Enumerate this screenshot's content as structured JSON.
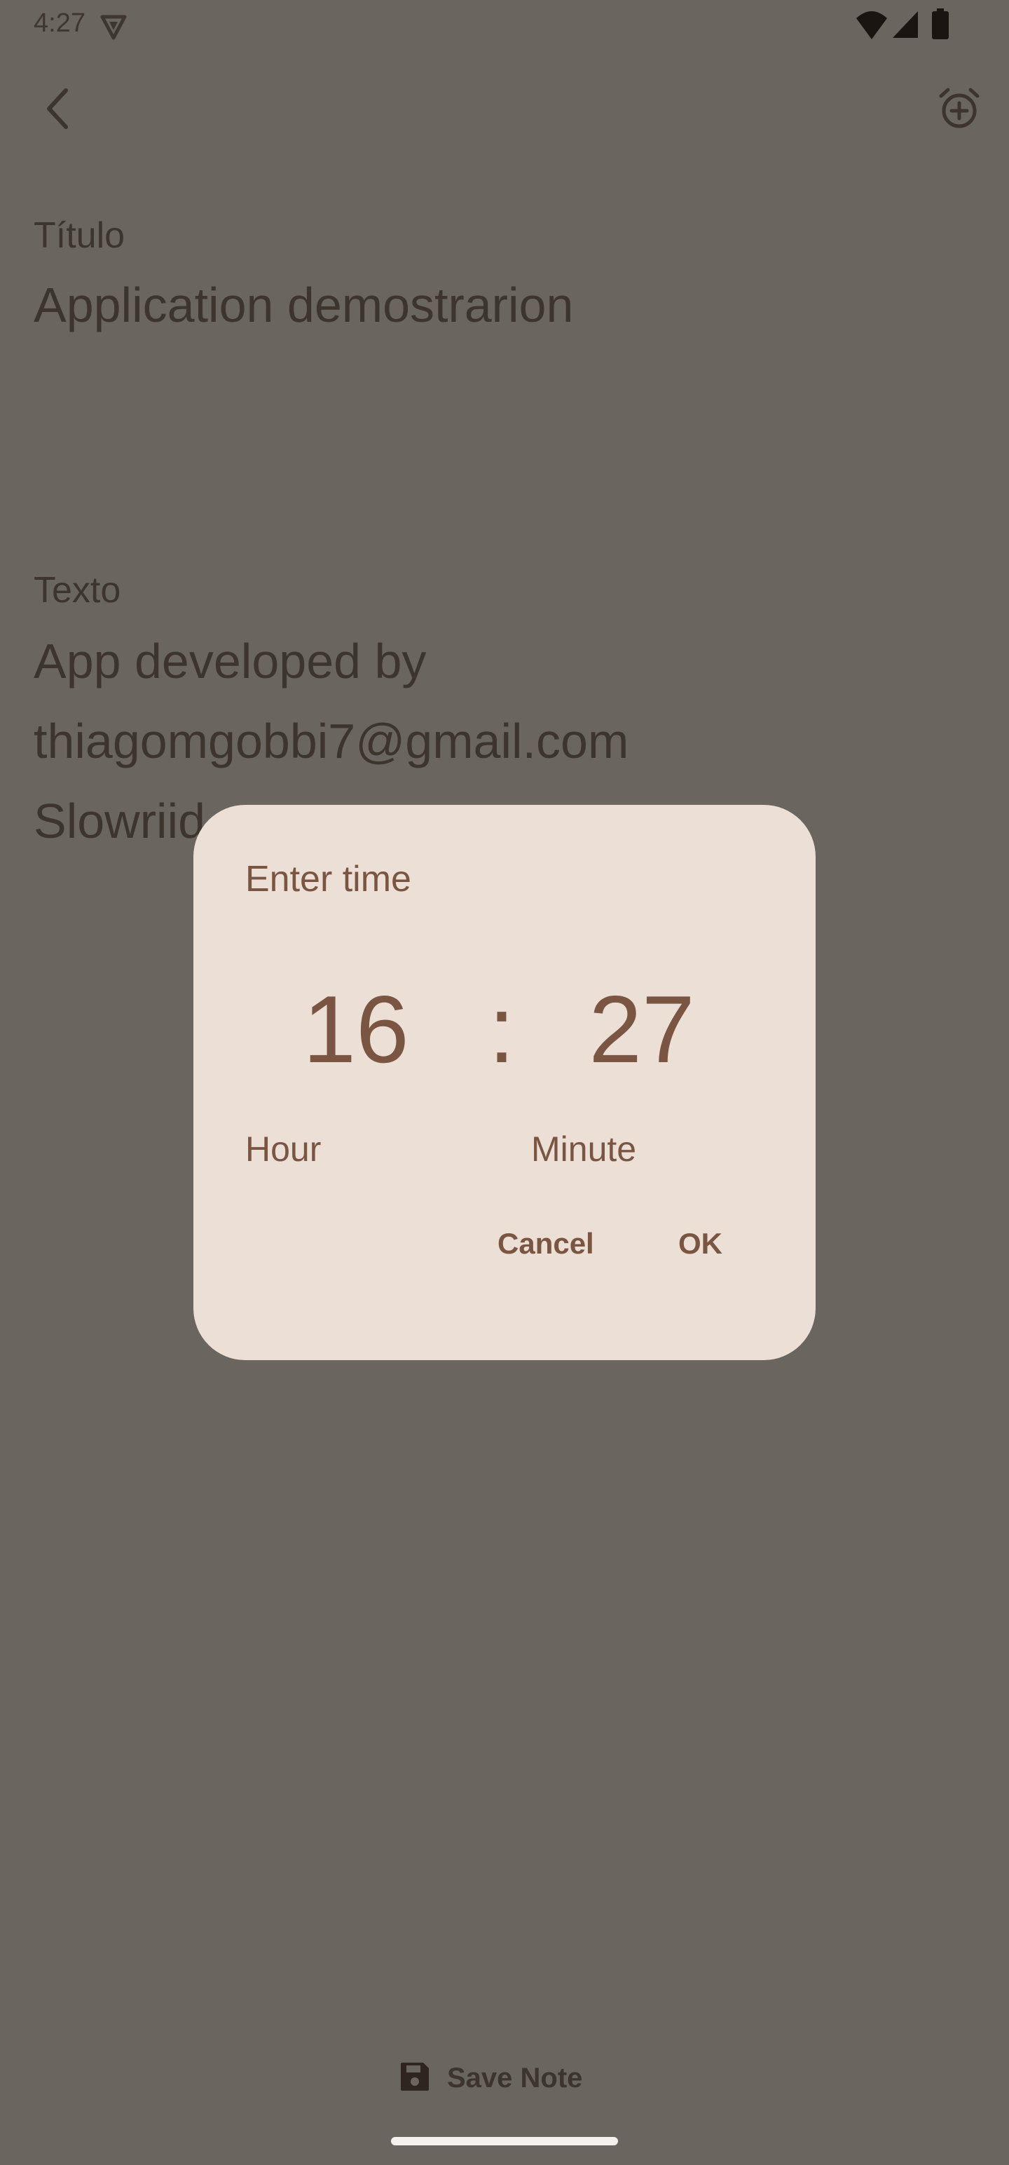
{
  "status_bar": {
    "time": "4:27",
    "icons": [
      "vpn-icon",
      "wifi-icon",
      "signal-icon",
      "battery-icon"
    ]
  },
  "toolbar": {
    "back_icon": "chevron-left-icon",
    "alarm_icon": "alarm-add-icon"
  },
  "note": {
    "title_label": "Título",
    "title_value": "Application demostrarion",
    "text_label": "Texto",
    "text_lines": [
      "App developed by",
      "thiagomgobbi7@gmail.com",
      "Slowriid"
    ]
  },
  "dialog": {
    "title": "Enter time",
    "hour": "16",
    "separator": ":",
    "minute": "27",
    "hour_label": "Hour",
    "minute_label": "Minute",
    "cancel_label": "Cancel",
    "ok_label": "OK"
  },
  "save_button": {
    "label": "Save Note",
    "icon": "save-icon"
  },
  "colors": {
    "scrim_background": "#6b6560",
    "dialog_surface": "#ece0d6",
    "accent_brown": "#7a5542",
    "text_dark": "#3e342e"
  }
}
